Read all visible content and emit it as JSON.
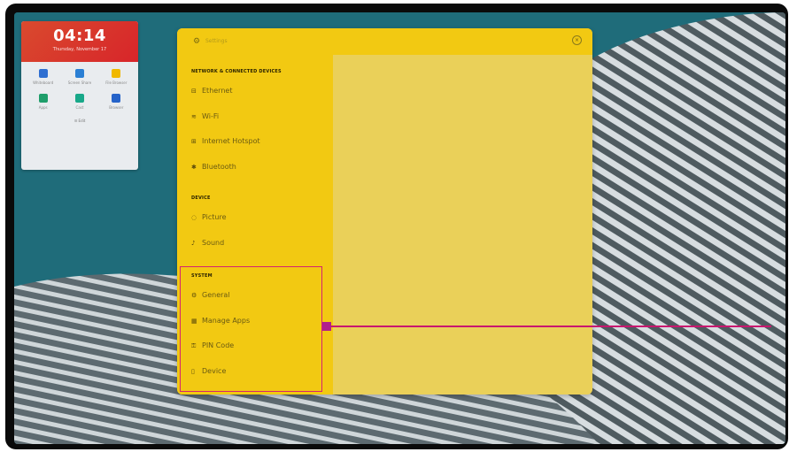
{
  "clock": {
    "time": "04:14",
    "date": "Thursday, November 17"
  },
  "widget_apps": [
    {
      "label": "Whiteboard",
      "icon": "whiteboard-icon",
      "color": "#2f6fd1"
    },
    {
      "label": "Screen Share",
      "icon": "screen-share-icon",
      "color": "#2a7fd4"
    },
    {
      "label": "File Browser",
      "icon": "folder-icon",
      "color": "#f0b800"
    },
    {
      "label": "Apps",
      "icon": "apps-icon",
      "color": "#1f9e6b"
    },
    {
      "label": "Cast",
      "icon": "cast-icon",
      "color": "#18a889"
    },
    {
      "label": "Browser",
      "icon": "globe-icon",
      "color": "#2563c9"
    }
  ],
  "widget_footer": "Edit",
  "panel": {
    "title": "Settings",
    "sections": [
      {
        "title": "NETWORK & CONNECTED DEVICES",
        "items": [
          {
            "label": "Ethernet",
            "icon": "ethernet-icon"
          },
          {
            "label": "Wi-Fi",
            "icon": "wifi-icon"
          },
          {
            "label": "Internet Hotspot",
            "icon": "hotspot-icon"
          },
          {
            "label": "Bluetooth",
            "icon": "bluetooth-icon"
          }
        ]
      },
      {
        "title": "DEVICE",
        "items": [
          {
            "label": "Picture",
            "icon": "picture-icon"
          },
          {
            "label": "Sound",
            "icon": "sound-icon"
          }
        ]
      },
      {
        "title": "SYSTEM",
        "items": [
          {
            "label": "General",
            "icon": "general-icon"
          },
          {
            "label": "Manage Apps",
            "icon": "manage-apps-icon"
          },
          {
            "label": "PIN Code",
            "icon": "pin-icon"
          },
          {
            "label": "Device",
            "icon": "device-icon"
          }
        ]
      }
    ]
  },
  "colors": {
    "highlight": "#d6246e",
    "panel_sidebar": "#f2c912",
    "panel_content": "#ead059",
    "clock_bg": "#d8302a"
  }
}
